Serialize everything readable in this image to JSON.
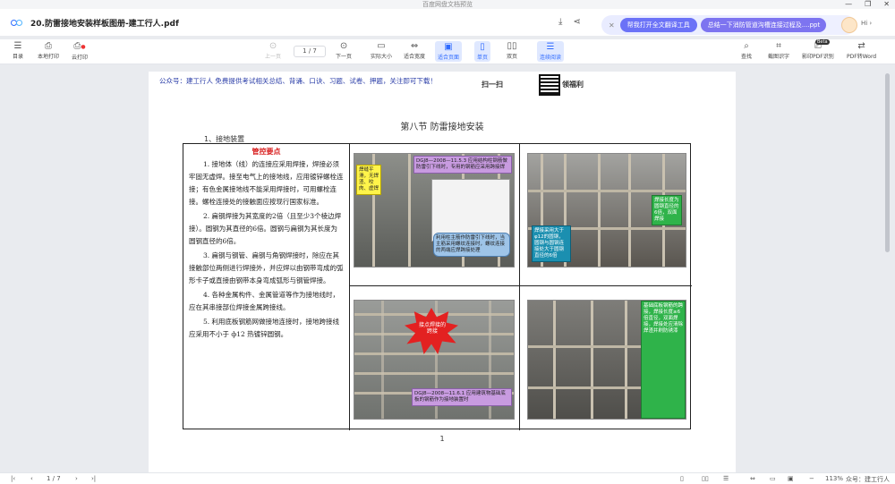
{
  "window": {
    "title": "百度网盘文档预览",
    "controls": [
      "—",
      "❐",
      "✕"
    ]
  },
  "header": {
    "doc_title": "20.防雷接地安装样板图册-建工行人.pdf",
    "ai_pill_1": "帮我打开全文翻译工具",
    "ai_pill_2": "总结一下消防管道沟槽连接过程及....ppt",
    "hi": "Hi ›"
  },
  "toolbar": {
    "catalog": "目录",
    "local_print": "本地打印",
    "cloud_print": "云打印",
    "prev": "上一页",
    "page_indicator": "1 / 7",
    "next": "下一页",
    "actual_size": "实际大小",
    "fit_width": "适合宽度",
    "fit_page": "适合页面",
    "single": "单页",
    "double": "双页",
    "continuous": "连续阅读",
    "search": "查找",
    "screenshot_ocr": "截图识字",
    "photo_pdf": "影印PDF识别",
    "pdf_to_word": "PDF转Word",
    "new_badge": "Beta"
  },
  "page": {
    "promo": "公众号：建工行人 免费提供考试相关总结、背诵、口诀、习题、试卷、押题，关注即可下载！",
    "scan_label": "扫一扫",
    "gift_label": "领福利",
    "section_title": "第八节 防雷接地安装",
    "subsection": "1、接地装置",
    "key_points": "管控要点",
    "paragraphs": [
      "1. 接地体（线）的连接应采用焊接，焊接必须牢固无虚焊。接至电气上的接地线，应用镀锌螺栓连接；有色金属接地线不能采用焊接时，可用螺栓连接。螺栓连接处的接触面应按现行国家标准。",
      "2. 扁钢焊接为其宽度的2倍（且至少3个棱边焊接）。圆钢为其直径的6倍。圆钢与扁钢为其长度为圆钢直径的6倍。",
      "3. 扁钢与钢管、扁钢与角钢焊接时，除应在其接触部位两侧进行焊接外，并应焊以由钢带弯成的弧形卡子或直接由钢带本身弯成弧形与钢管焊接。",
      "4. 各种金属构件、金属管道等作为接地线时，应在其串接部位焊接金属跨接线。",
      "5. 利用底板钢筋网做接地连接时，接地跨接线应采用不小于 ф12 热镀锌圆钢。"
    ],
    "notes": {
      "p1_yellow": "焊缝平滑，无焊渣、咬肉、虚焊",
      "p1_purple": "DGJ8—2008—11.5.3 应用结构柱钢筋做防雷引下线时，专用的钢筋应采用跨接焊",
      "p1_blue": "利用柱主筋作防雷引下线时，当主筋采用螺纹连接时，螺纹连接的两端应焊跨接处理",
      "p2_green": "焊接长度为圆钢直径的6倍，双面焊接",
      "p2_teal": "焊接采用大于φ12的圆钢，圆钢与圆钢连接处大于圆钢直径的6倍",
      "p3_burst": "接点焊接的跨接",
      "p3_purple": "DGJ8—2008—11.6.1 应用建筑物基础底板的钢筋作为接地装置时",
      "p4_green": "基础底板钢筋的跨接，焊接长度≥6倍直径，双面焊接，焊接处应清除焊渣并刷防锈漆"
    },
    "page_number": "1"
  },
  "status": {
    "page": "1 / 7",
    "zoom": "113%",
    "watermark": "众号：建工行人"
  }
}
